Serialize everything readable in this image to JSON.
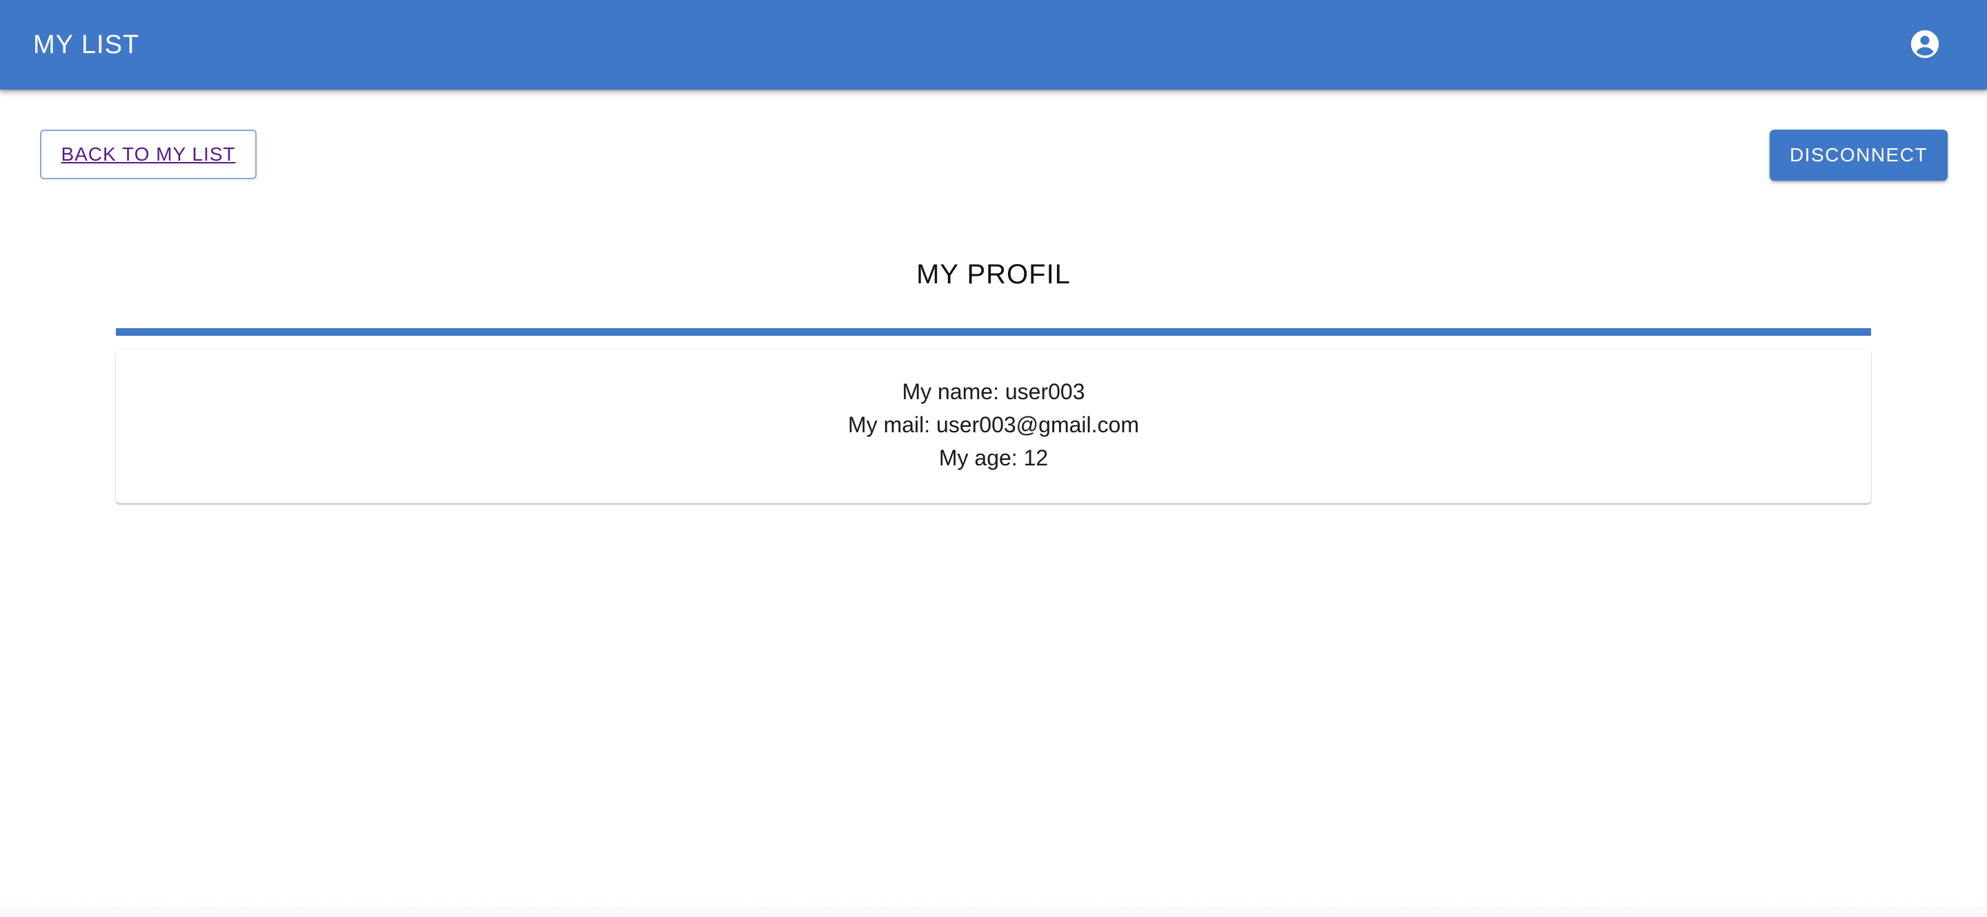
{
  "appbar": {
    "title": "MY LIST",
    "account_icon": "account-circle-icon"
  },
  "actions": {
    "back_label": "BACK TO MY LIST",
    "disconnect_label": "DISCONNECT"
  },
  "profile": {
    "title": "MY PROFIL",
    "name_line": "My name: user003",
    "mail_line": "My mail: user003@gmail.com",
    "age_line": "My age: 12"
  },
  "colors": {
    "primary": "#3f78c7",
    "link_visited": "#551a8b",
    "text": "#1a1a1a",
    "background": "#ffffff"
  }
}
